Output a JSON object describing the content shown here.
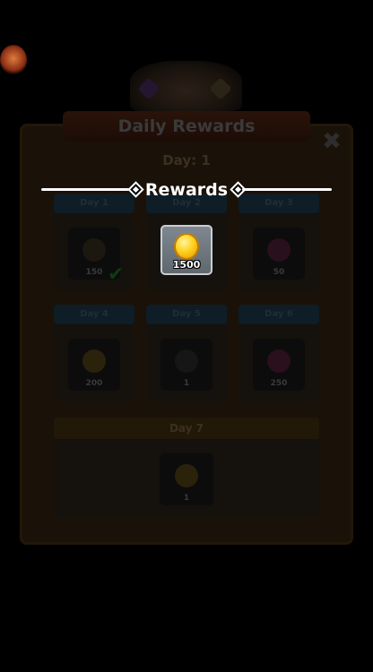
{
  "background": {
    "title": "Daily Rewards",
    "current_day": "Day: 1",
    "days": [
      {
        "label": "Day 1",
        "icon": "gem-icon",
        "amount": "150"
      },
      {
        "label": "Day 2",
        "icon": "coin-icon",
        "amount": "1500"
      },
      {
        "label": "Day 3",
        "icon": "gem-icon",
        "amount": "50"
      },
      {
        "label": "Day 4",
        "icon": "coin-icon",
        "amount": "200"
      },
      {
        "label": "Day 5",
        "icon": "key-icon",
        "amount": "1"
      },
      {
        "label": "Day 6",
        "icon": "gem-icon",
        "amount": "250"
      }
    ],
    "day7": {
      "label": "Day 7",
      "icon": "key-icon",
      "amount": "1"
    }
  },
  "popup": {
    "title": "Rewards",
    "reward": {
      "icon": "coin-icon",
      "amount": "1500"
    }
  },
  "colors": {
    "overlay": "#000000",
    "coin": "#ffd21f",
    "tile": "#6f7880"
  }
}
